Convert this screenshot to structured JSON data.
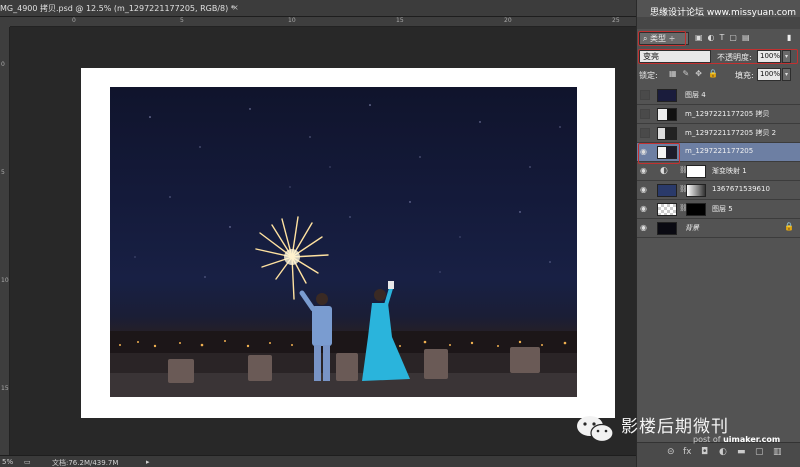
{
  "document": {
    "tab_title": "MG_4900 拷贝.psd @ 12.5% (m_1297221177205, RGB/8) *",
    "close_glyph": "×"
  },
  "rulers": {
    "horizontal_labels": [
      "0",
      "5",
      "10",
      "15",
      "20",
      "25"
    ],
    "vertical_labels": [
      "0",
      "5",
      "10",
      "15"
    ]
  },
  "status": {
    "zoom": "5%",
    "doc_info": "文档:76.2M/439.7M"
  },
  "watermark": "思缘设计论坛 www.missyuan.com",
  "layers_panel": {
    "filter_kind": "类型",
    "blend_mode": "变亮",
    "opacity_label": "不透明度:",
    "opacity_value": "100%",
    "lock_label": "锁定:",
    "fill_label": "填充:",
    "fill_value": "100%",
    "layers": [
      {
        "name": "图层 4",
        "visible": false,
        "selected": false
      },
      {
        "name": "m_1297221177205 拷贝",
        "visible": false,
        "selected": false
      },
      {
        "name": "m_1297221177205 拷贝 2",
        "visible": false,
        "selected": false
      },
      {
        "name": "m_1297221177205",
        "visible": true,
        "selected": true
      },
      {
        "name": "渐变映射 1",
        "visible": true,
        "selected": false
      },
      {
        "name": "1367671539610",
        "visible": true,
        "selected": false
      },
      {
        "name": "图层 5",
        "visible": true,
        "selected": false
      },
      {
        "name": "背景",
        "visible": true,
        "selected": false
      }
    ]
  },
  "logo": {
    "title": "影楼后期微刊",
    "sub_prefix": "post of",
    "sub_site": "uimaker.com"
  },
  "colors": {
    "panel_bg": "#535353",
    "selected_layer": "#6d7fa3",
    "annotation_red": "#c23030",
    "workspace": "#282828"
  }
}
